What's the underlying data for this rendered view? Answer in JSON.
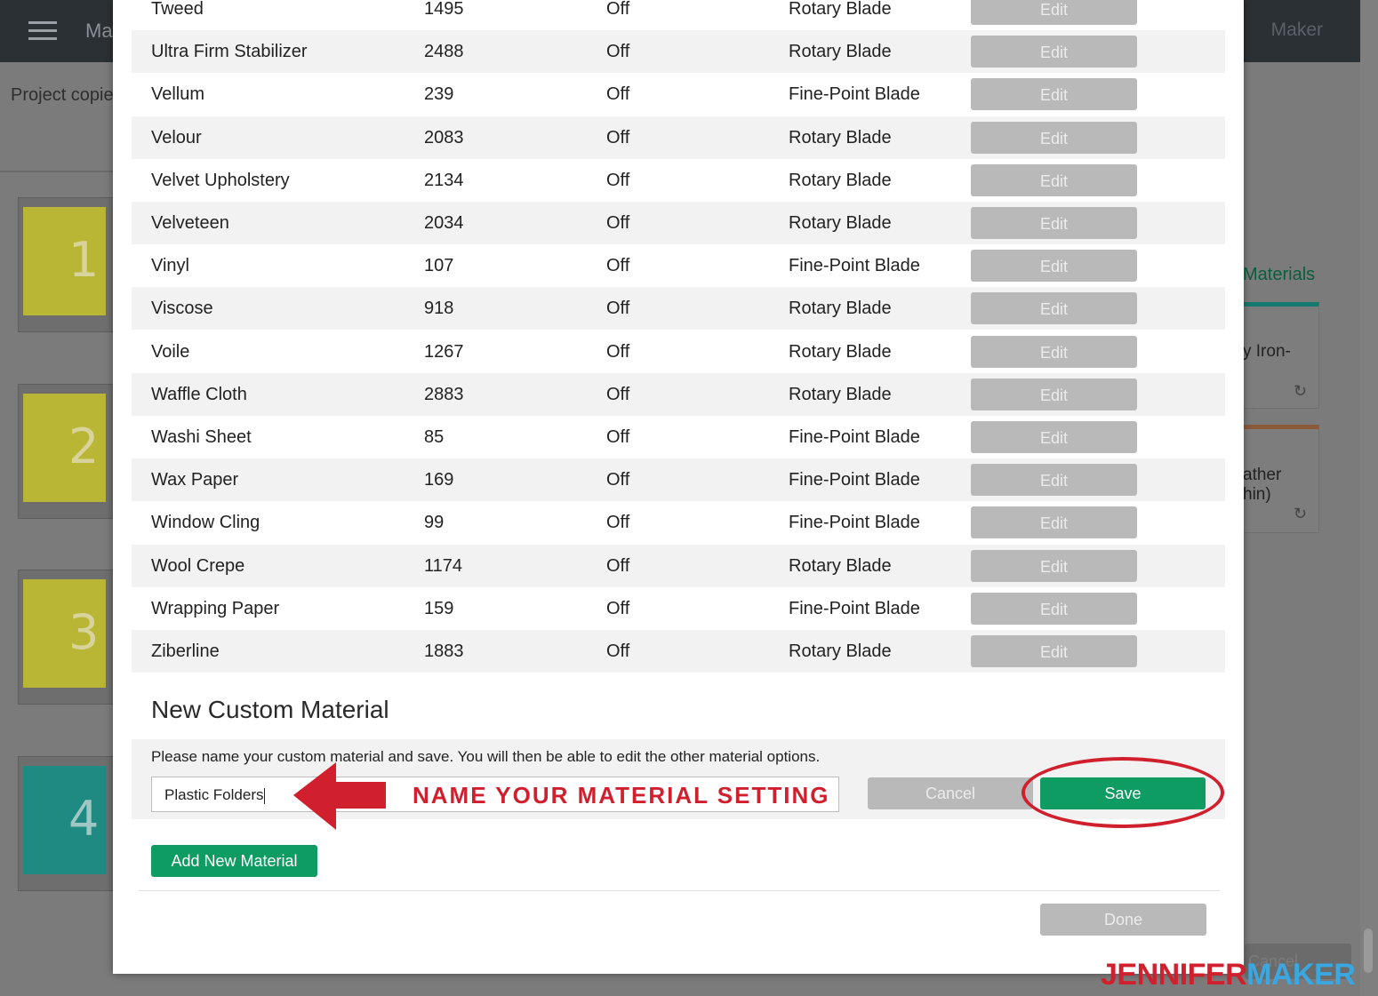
{
  "app": {
    "title": "Ma",
    "right_label": "Maker",
    "project_label": "Project copie"
  },
  "mats": [
    "1",
    "2",
    "3",
    "4"
  ],
  "right_panel": {
    "title": "Materials",
    "card1_text": "y Iron-",
    "card2_text_line1": "ather",
    "card2_text_line2": "hin)",
    "cancel_label": "Cancel"
  },
  "materials": [
    {
      "name": "Tweed",
      "id": "1495",
      "state": "Off",
      "blade": "Rotary Blade",
      "action": "Edit"
    },
    {
      "name": "Ultra Firm Stabilizer",
      "id": "2488",
      "state": "Off",
      "blade": "Rotary Blade",
      "action": "Edit"
    },
    {
      "name": "Vellum",
      "id": "239",
      "state": "Off",
      "blade": "Fine-Point Blade",
      "action": "Edit"
    },
    {
      "name": "Velour",
      "id": "2083",
      "state": "Off",
      "blade": "Rotary Blade",
      "action": "Edit"
    },
    {
      "name": "Velvet Upholstery",
      "id": "2134",
      "state": "Off",
      "blade": "Rotary Blade",
      "action": "Edit"
    },
    {
      "name": "Velveteen",
      "id": "2034",
      "state": "Off",
      "blade": "Rotary Blade",
      "action": "Edit"
    },
    {
      "name": "Vinyl",
      "id": "107",
      "state": "Off",
      "blade": "Fine-Point Blade",
      "action": "Edit"
    },
    {
      "name": "Viscose",
      "id": "918",
      "state": "Off",
      "blade": "Rotary Blade",
      "action": "Edit"
    },
    {
      "name": "Voile",
      "id": "1267",
      "state": "Off",
      "blade": "Rotary Blade",
      "action": "Edit"
    },
    {
      "name": "Waffle Cloth",
      "id": "2883",
      "state": "Off",
      "blade": "Rotary Blade",
      "action": "Edit"
    },
    {
      "name": "Washi Sheet",
      "id": "85",
      "state": "Off",
      "blade": "Fine-Point Blade",
      "action": "Edit"
    },
    {
      "name": "Wax Paper",
      "id": "169",
      "state": "Off",
      "blade": "Fine-Point Blade",
      "action": "Edit"
    },
    {
      "name": "Window Cling",
      "id": "99",
      "state": "Off",
      "blade": "Fine-Point Blade",
      "action": "Edit"
    },
    {
      "name": "Wool Crepe",
      "id": "1174",
      "state": "Off",
      "blade": "Rotary Blade",
      "action": "Edit"
    },
    {
      "name": "Wrapping Paper",
      "id": "159",
      "state": "Off",
      "blade": "Fine-Point Blade",
      "action": "Edit"
    },
    {
      "name": "Ziberline",
      "id": "1883",
      "state": "Off",
      "blade": "Rotary Blade",
      "action": "Edit"
    }
  ],
  "new_material": {
    "title": "New Custom Material",
    "instructions": "Please name your custom material and save. You will then be able to edit the other material options.",
    "input_value": "Plastic Folders",
    "cancel_label": "Cancel",
    "save_label": "Save"
  },
  "add_button_label": "Add New Material",
  "done_label": "Done",
  "annotation": {
    "text": "NAME YOUR MATERIAL SETTING",
    "color": "#d0202e"
  },
  "brand": {
    "part1": "JENNIFER",
    "part2": "MAKER"
  },
  "colors": {
    "accent_green": "#0e9c62",
    "disabled_gray": "#b9b9b9",
    "annotation_red": "#d0202e"
  }
}
